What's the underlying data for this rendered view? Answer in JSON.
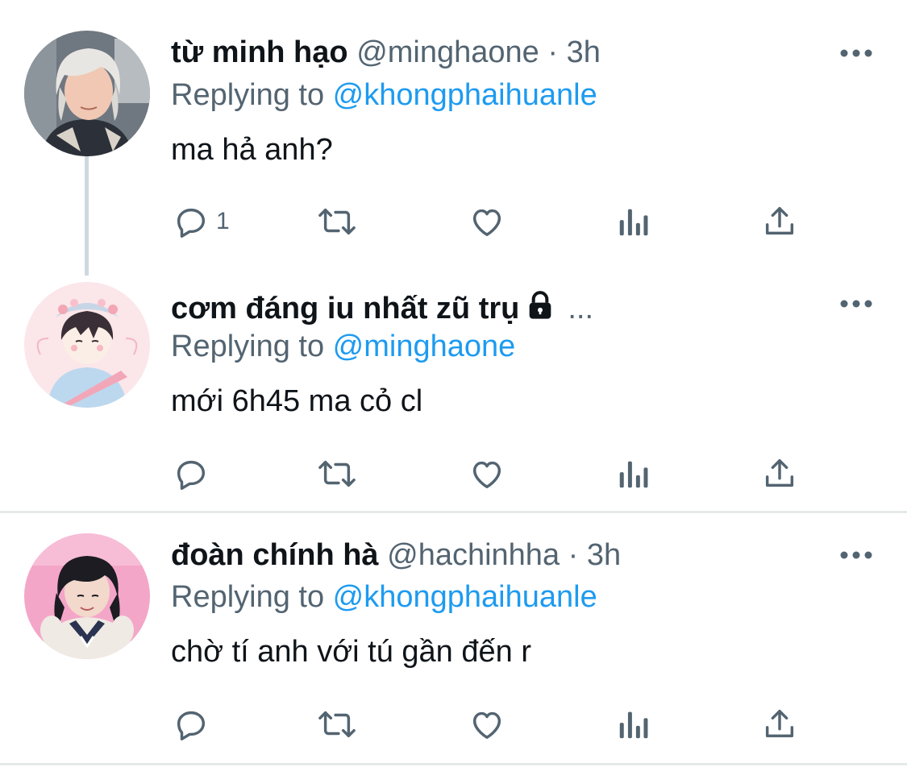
{
  "tweets": [
    {
      "name": "từ minh hạo",
      "handle": "@minghaone",
      "separator": "·",
      "time": "3h",
      "replying_prefix": "Replying to ",
      "replying_to": "@khongphaihuanle",
      "text": "ma hả anh?",
      "reply_count": "1",
      "avatar_colors": {
        "bg": "#5a6470",
        "hair": "#e8e6e2",
        "skin": "#f0c8b4"
      }
    },
    {
      "name": "cơm đáng iu nhất zũ trụ",
      "ellipsis": "...",
      "locked": true,
      "replying_prefix": "Replying to ",
      "replying_to": "@minghaone",
      "text": "mới 6h45 ma cỏ cl",
      "reply_count": "",
      "avatar_colors": {
        "bg": "#fbe6ea",
        "shirt": "#bcd8ee",
        "hat": "#c7d6e6"
      }
    },
    {
      "name": "đoàn chính hà",
      "handle": "@hachinhha",
      "separator": "·",
      "time": "3h",
      "replying_prefix": "Replying to ",
      "replying_to": "@khongphaihuanle",
      "text": "chờ tí anh với tú gần đến r",
      "reply_count": "",
      "avatar_colors": {
        "bg": "#f4a6c8",
        "hair": "#1c1c22",
        "skin": "#f3d8cc"
      }
    }
  ],
  "colors": {
    "accent": "#1d9bf0",
    "secondary": "#536471",
    "primary_text": "#0f1419",
    "divider": "#e6e9ea"
  },
  "icons": [
    "reply-icon",
    "retweet-icon",
    "like-icon",
    "analytics-icon",
    "share-icon",
    "more-icon",
    "lock-icon"
  ]
}
